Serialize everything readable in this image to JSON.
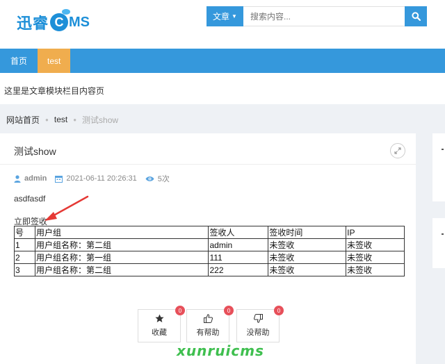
{
  "logo": {
    "part1": "迅睿",
    "c": "C",
    "part2": "MS"
  },
  "search": {
    "category": "文章",
    "placeholder": "搜索内容..."
  },
  "nav": {
    "items": [
      "首页",
      "test"
    ]
  },
  "intro": "这里是文章模块栏目内容页",
  "breadcrumb": [
    "网站首页",
    "test",
    "测试show"
  ],
  "article": {
    "title": "测试show",
    "author": "admin",
    "datetime": "2021-06-11 20:26:31",
    "views": "5次",
    "body": "asdfasdf",
    "sign_link": "立即签收"
  },
  "sign_table": {
    "headers": [
      "号",
      "用户组",
      "签收人",
      "签收时间",
      "IP"
    ],
    "rows": [
      [
        "1",
        "用户组名称：第二组",
        "admin",
        "未签收",
        "未签收"
      ],
      [
        "2",
        "用户组名称：第一组",
        "111",
        "未签收",
        "未签收"
      ],
      [
        "3",
        "用户组名称：第二组",
        "222",
        "未签收",
        "未签收"
      ]
    ]
  },
  "actions": [
    {
      "label": "收藏",
      "count": "0",
      "icon": "star-icon"
    },
    {
      "label": "有帮助",
      "count": "0",
      "icon": "thumbs-up-icon"
    },
    {
      "label": "没帮助",
      "count": "0",
      "icon": "thumbs-down-icon"
    }
  ],
  "watermark": "xunruicms",
  "colors": {
    "primary": "#3598dc",
    "active_tab": "#f0ad4e",
    "badge": "#e7505a",
    "arrow": "#e53935",
    "watermark": "#3fbf4f"
  }
}
